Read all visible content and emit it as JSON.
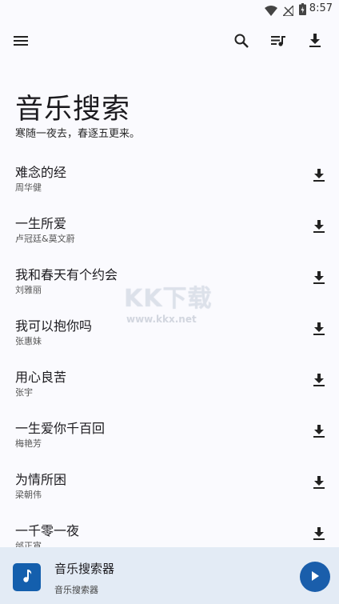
{
  "status_bar": {
    "time": "8:57",
    "icons": [
      "wifi-icon",
      "no-signal-icon",
      "battery-charging-icon"
    ]
  },
  "top_bar": {
    "icons": [
      "menu-icon",
      "search-icon",
      "queue-music-icon",
      "download-icon"
    ]
  },
  "header": {
    "title": "音乐搜索",
    "subtitle": "寒随一夜去，春逐五更来。"
  },
  "songs": [
    {
      "title": "难念的经",
      "artist": "周华健"
    },
    {
      "title": "一生所爱",
      "artist": "卢冠廷&莫文蔚"
    },
    {
      "title": "我和春天有个约会",
      "artist": "刘雅丽"
    },
    {
      "title": "我可以抱你吗",
      "artist": "张惠妹"
    },
    {
      "title": "用心良苦",
      "artist": "张宇"
    },
    {
      "title": "一生爱你千百回",
      "artist": "梅艳芳"
    },
    {
      "title": "为情所困",
      "artist": "梁朝伟"
    },
    {
      "title": "一千零一夜",
      "artist": "邰正宵"
    }
  ],
  "watermark": {
    "logo": "KK下载",
    "url": "www.kkx.net"
  },
  "mini_player": {
    "title": "音乐搜索器",
    "subtitle": "音乐搜索器",
    "art_icon": "music-note-icon",
    "play_icon": "play-icon"
  },
  "colors": {
    "background": "#fafafe",
    "player_bar": "#e3ebf5",
    "accent": "#1a5eab"
  }
}
